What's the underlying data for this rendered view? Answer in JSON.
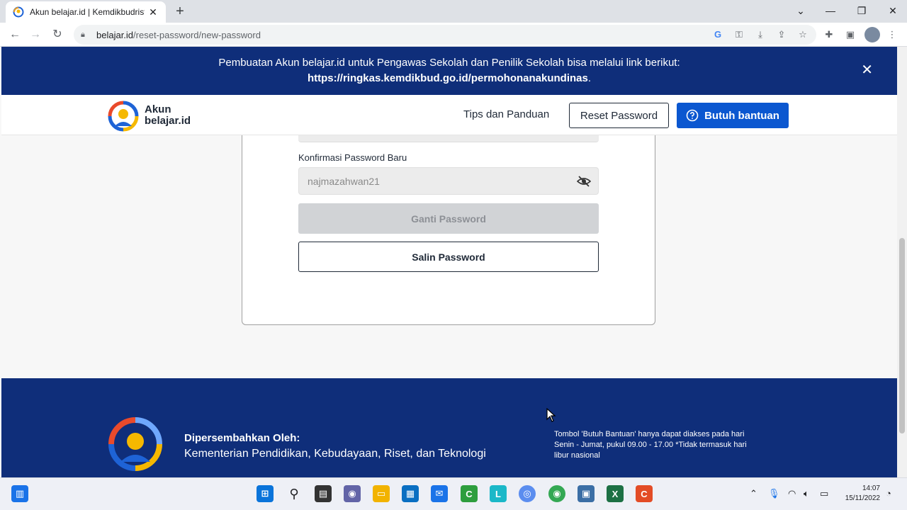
{
  "browser": {
    "tab_title": "Akun belajar.id | Kemdikbudriste",
    "url_host": "belajar.id",
    "url_path": "/reset-password/new-password"
  },
  "banner": {
    "text": "Pembuatan Akun belajar.id untuk Pengawas Sekolah dan Penilik Sekolah bisa melalui link berikut:",
    "link": "https://ringkas.kemdikbud.go.id/permohonanakundinas",
    "link_suffix": "."
  },
  "header": {
    "logo_line1": "Akun",
    "logo_line2": "belajar.id",
    "tips_label": "Tips dan Panduan",
    "reset_label": "Reset Password",
    "help_label": "Butuh bantuan"
  },
  "form": {
    "confirm_label": "Konfirmasi Password Baru",
    "confirm_value": "najmazahwan21",
    "ganti_label": "Ganti Password",
    "salin_label": "Salin Password"
  },
  "footer": {
    "by_label": "Dipersembahkan Oleh:",
    "org": "Kementerian Pendidikan, Kebudayaan, Riset, dan Teknologi",
    "note": "Tombol 'Butuh Bantuan' hanya dapat diakses pada hari Senin - Jumat, pukul 09.00 - 17.00 *Tidak termasuk hari libur nasional"
  },
  "taskbar": {
    "time": "14:07",
    "date": "15/11/2022"
  },
  "colors": {
    "brand_navy": "#0f2e7a",
    "primary_blue": "#0b57d0"
  }
}
